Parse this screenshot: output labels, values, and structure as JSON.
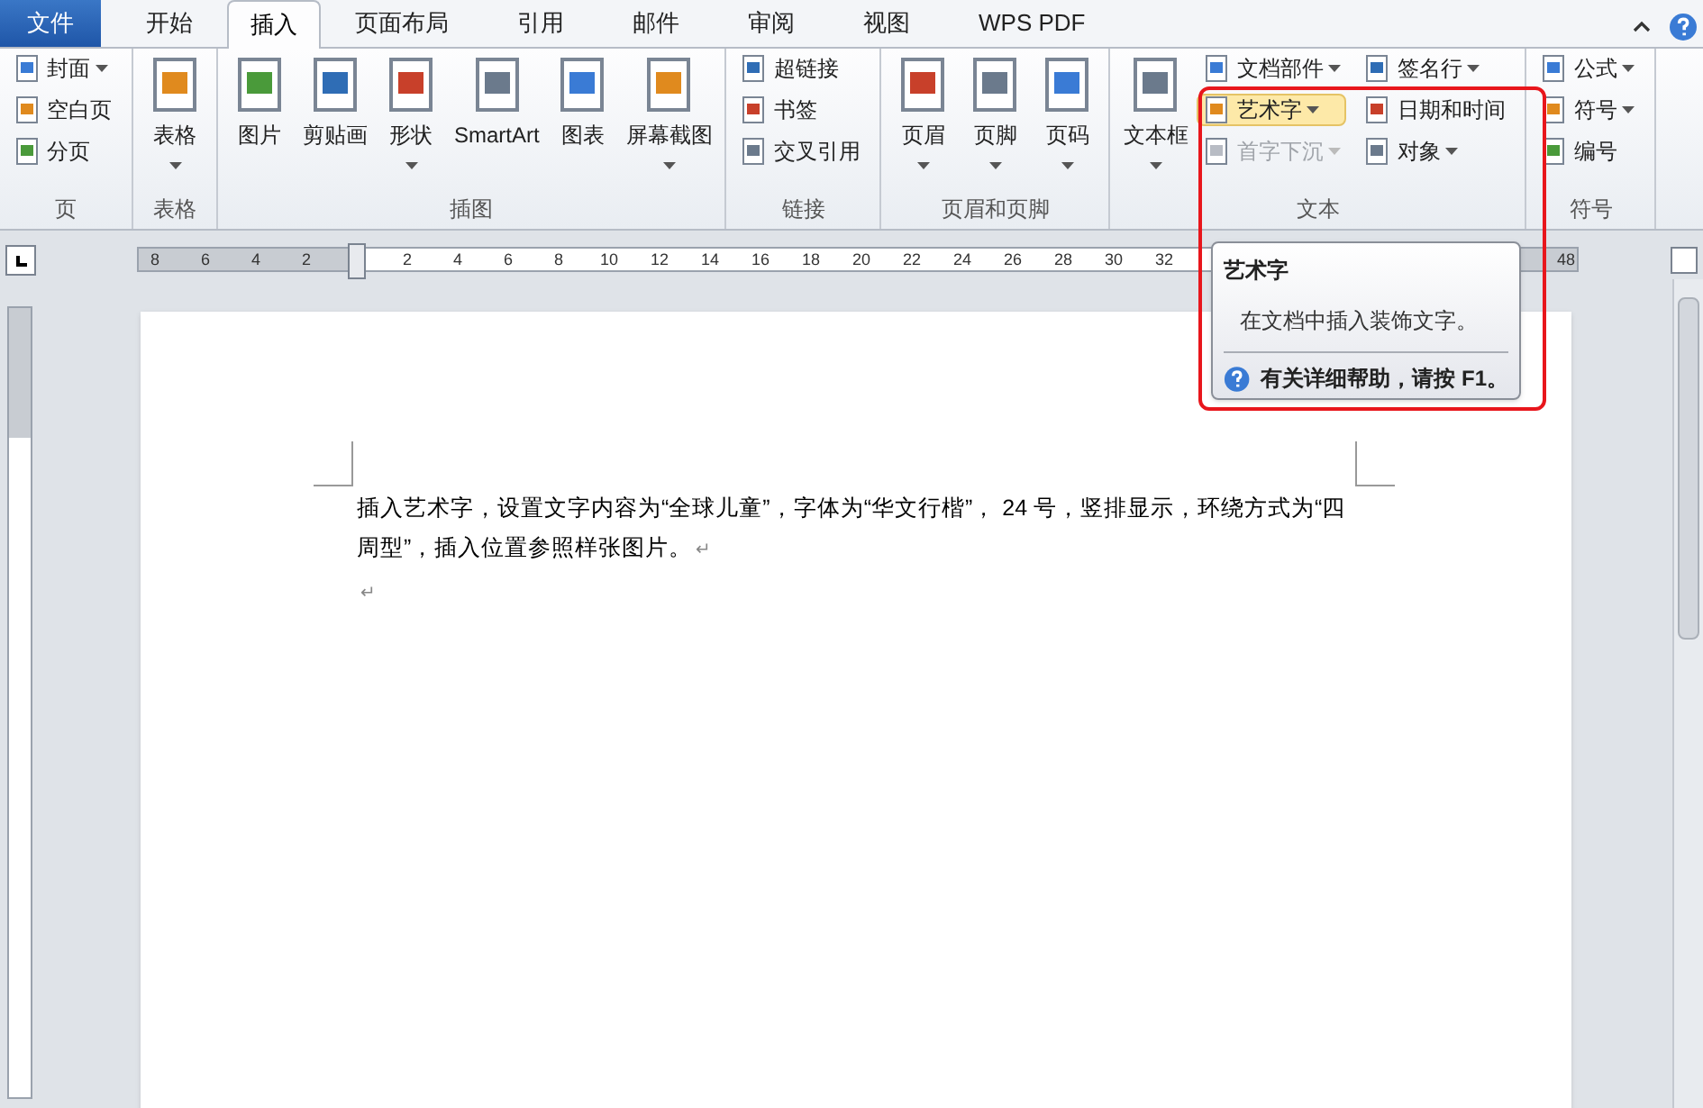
{
  "menu_tabs": [
    {
      "label": "文件",
      "kind": "file",
      "selected": false
    },
    {
      "label": "开始",
      "kind": "tab",
      "selected": false
    },
    {
      "label": "插入",
      "kind": "tab",
      "selected": true
    },
    {
      "label": "页面布局",
      "kind": "tab",
      "selected": false
    },
    {
      "label": "引用",
      "kind": "tab",
      "selected": false
    },
    {
      "label": "邮件",
      "kind": "tab",
      "selected": false
    },
    {
      "label": "审阅",
      "kind": "tab",
      "selected": false
    },
    {
      "label": "视图",
      "kind": "tab",
      "selected": false
    },
    {
      "label": "WPS PDF",
      "kind": "tab",
      "selected": false
    }
  ],
  "ribbon_groups": [
    {
      "label": "页",
      "items": [
        {
          "label": "封面",
          "kind": "small",
          "dropdown": true,
          "disabled": false,
          "hovered": false
        },
        {
          "label": "空白页",
          "kind": "small",
          "dropdown": false,
          "disabled": false,
          "hovered": false
        },
        {
          "label": "分页",
          "kind": "small",
          "dropdown": false,
          "disabled": false,
          "hovered": false
        }
      ]
    },
    {
      "label": "表格",
      "items": [
        {
          "label": "表格",
          "kind": "large",
          "dropdown": true,
          "disabled": false,
          "hovered": false
        }
      ]
    },
    {
      "label": "插图",
      "items": [
        {
          "label": "图片",
          "kind": "large",
          "dropdown": false,
          "disabled": false,
          "hovered": false
        },
        {
          "label": "剪贴画",
          "kind": "large",
          "dropdown": false,
          "disabled": false,
          "hovered": false
        },
        {
          "label": "形状",
          "kind": "large",
          "dropdown": true,
          "disabled": false,
          "hovered": false
        },
        {
          "label": "SmartArt",
          "kind": "large",
          "dropdown": false,
          "disabled": false,
          "hovered": false
        },
        {
          "label": "图表",
          "kind": "large",
          "dropdown": false,
          "disabled": false,
          "hovered": false
        },
        {
          "label": "屏幕截图",
          "kind": "large",
          "dropdown": true,
          "disabled": false,
          "hovered": false
        }
      ]
    },
    {
      "label": "链接",
      "items": [
        {
          "label": "超链接",
          "kind": "small",
          "dropdown": false,
          "disabled": false,
          "hovered": false
        },
        {
          "label": "书签",
          "kind": "small",
          "dropdown": false,
          "disabled": false,
          "hovered": false
        },
        {
          "label": "交叉引用",
          "kind": "small",
          "dropdown": false,
          "disabled": false,
          "hovered": false
        }
      ]
    },
    {
      "label": "页眉和页脚",
      "items": [
        {
          "label": "页眉",
          "kind": "large",
          "dropdown": true,
          "disabled": false,
          "hovered": false
        },
        {
          "label": "页脚",
          "kind": "large",
          "dropdown": true,
          "disabled": false,
          "hovered": false
        },
        {
          "label": "页码",
          "kind": "large",
          "dropdown": true,
          "disabled": false,
          "hovered": false
        }
      ]
    },
    {
      "label": "文本",
      "items": [
        {
          "label": "文本框",
          "kind": "large",
          "dropdown": true,
          "disabled": false,
          "hovered": false
        },
        {
          "label": "文档部件",
          "kind": "small",
          "dropdown": true,
          "disabled": false,
          "hovered": false
        },
        {
          "label": "艺术字",
          "kind": "small",
          "dropdown": true,
          "disabled": false,
          "hovered": true
        },
        {
          "label": "首字下沉",
          "kind": "small",
          "dropdown": true,
          "disabled": true,
          "hovered": false
        },
        {
          "label": "签名行",
          "kind": "small",
          "dropdown": true,
          "disabled": false,
          "hovered": false
        },
        {
          "label": "日期和时间",
          "kind": "small",
          "dropdown": false,
          "disabled": false,
          "hovered": false
        },
        {
          "label": "对象",
          "kind": "small",
          "dropdown": true,
          "disabled": false,
          "hovered": false
        }
      ]
    },
    {
      "label": "符号",
      "items": [
        {
          "label": "公式",
          "kind": "small",
          "dropdown": true,
          "disabled": false,
          "hovered": false
        },
        {
          "label": "符号",
          "kind": "small",
          "dropdown": true,
          "disabled": false,
          "hovered": false
        },
        {
          "label": "编号",
          "kind": "small",
          "dropdown": false,
          "disabled": false,
          "hovered": false
        }
      ]
    }
  ],
  "ruler": {
    "left_labels": [
      "8",
      "6",
      "4",
      "2"
    ],
    "right_labels": [
      "2",
      "4",
      "6",
      "8",
      "10",
      "12",
      "14",
      "16",
      "18",
      "20",
      "22",
      "24",
      "26",
      "28",
      "30",
      "32"
    ],
    "far_right_labels": [
      "48"
    ]
  },
  "tooltip": {
    "title": "艺术字",
    "description": "在文档中插入装饰文字。",
    "help": "有关详细帮助，请按 F1。"
  },
  "document": {
    "paragraphs": [
      {
        "text": "插入艺术字，设置文字内容为“全球儿童”，字体为“华文行楷”， 24 号，竖排显示，环绕方式为“四周型”，插入位置参照样张图片。",
        "mark": "↵"
      },
      {
        "mark": "↵"
      }
    ]
  }
}
